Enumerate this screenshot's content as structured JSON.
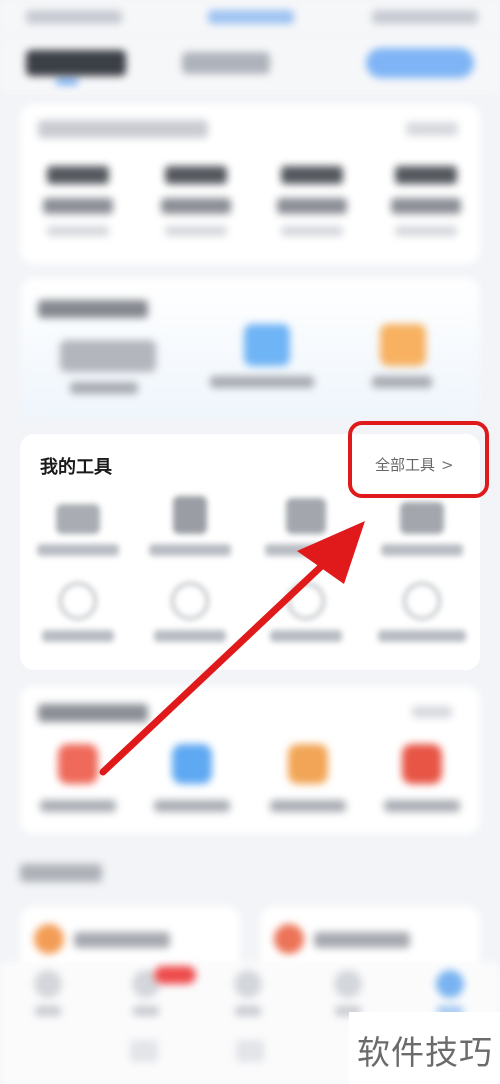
{
  "tools_section": {
    "title": "我的工具",
    "all_tools_label": "全部工具",
    "chevron": ">"
  },
  "watermark": {
    "text": "软件技巧"
  },
  "colors": {
    "accent_blue": "#2e86f5",
    "highlight_red": "#e01a1a",
    "page_background": "#f2f4f7"
  },
  "icons": [
    "chevron-right-icon",
    "tool-icon",
    "arrow-annotation-icon"
  ]
}
